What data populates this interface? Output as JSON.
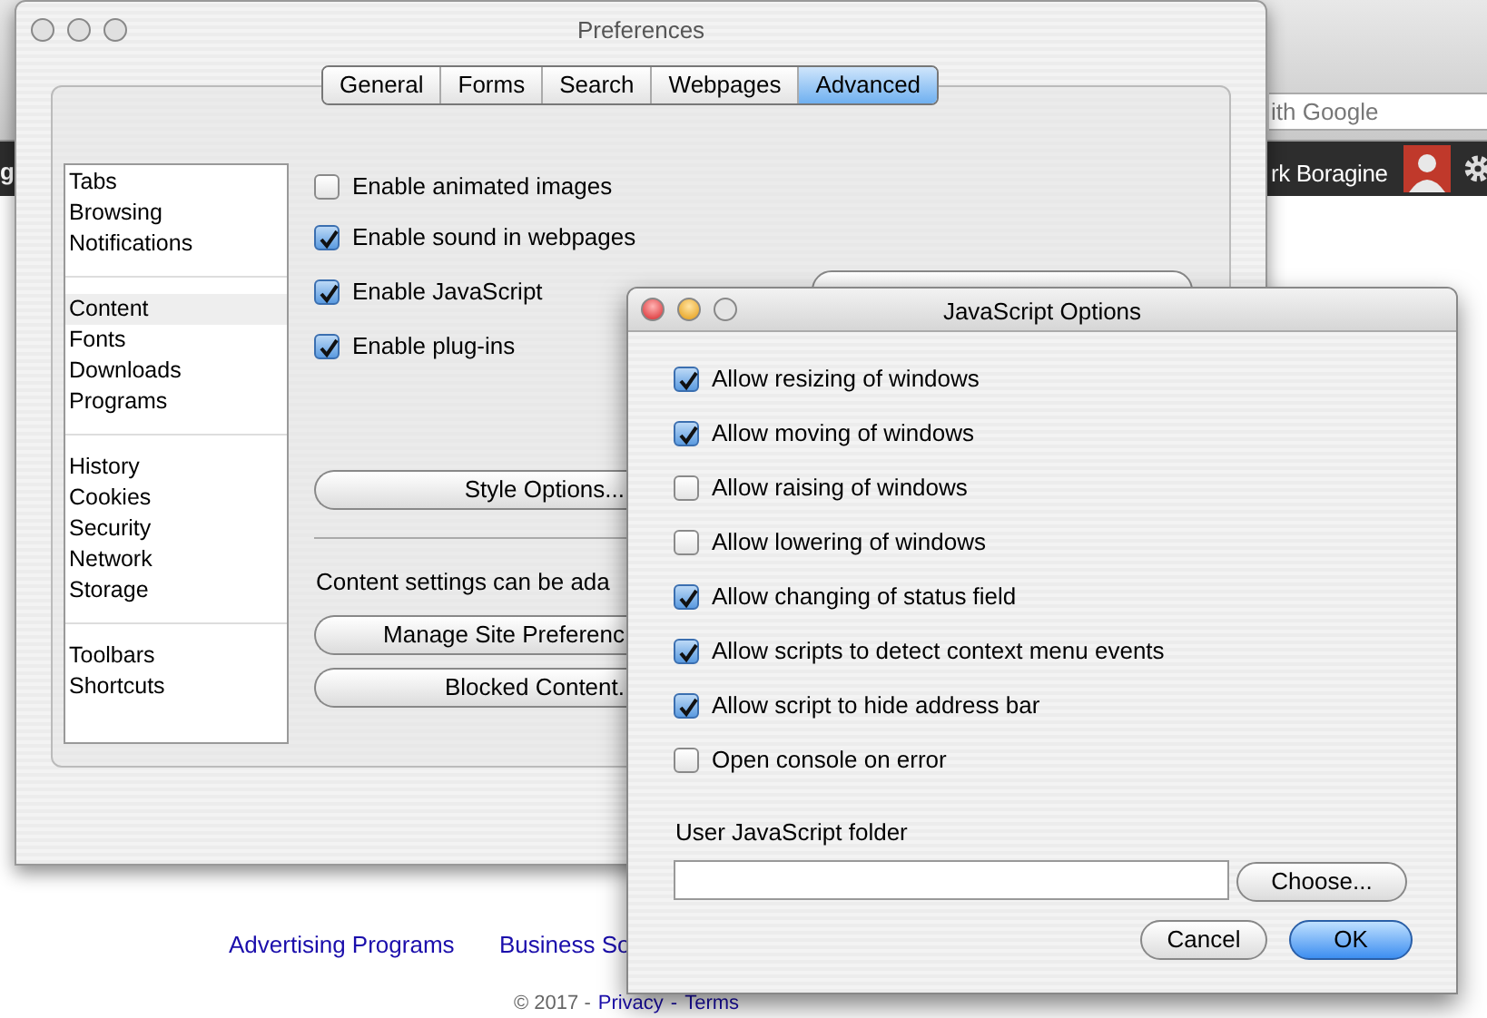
{
  "browser": {
    "search_placeholder": "ith Google",
    "left_fragment": "g",
    "user_name": "rk Boragine",
    "footer_links": [
      "Advertising Programs",
      "Business So"
    ],
    "copyright": "© 2017 -",
    "privacy": "Privacy",
    "separator": "-",
    "terms": "Terms"
  },
  "preferences": {
    "title": "Preferences",
    "tabs": [
      {
        "label": "General",
        "selected": false
      },
      {
        "label": "Forms",
        "selected": false
      },
      {
        "label": "Search",
        "selected": false
      },
      {
        "label": "Webpages",
        "selected": false
      },
      {
        "label": "Advanced",
        "selected": true
      }
    ],
    "sidebar": [
      [
        {
          "label": "Tabs",
          "selected": false
        },
        {
          "label": "Browsing",
          "selected": false
        },
        {
          "label": "Notifications",
          "selected": false
        }
      ],
      [
        {
          "label": "Content",
          "selected": true
        },
        {
          "label": "Fonts",
          "selected": false
        },
        {
          "label": "Downloads",
          "selected": false
        },
        {
          "label": "Programs",
          "selected": false
        }
      ],
      [
        {
          "label": "History",
          "selected": false
        },
        {
          "label": "Cookies",
          "selected": false
        },
        {
          "label": "Security",
          "selected": false
        },
        {
          "label": "Network",
          "selected": false
        },
        {
          "label": "Storage",
          "selected": false
        }
      ],
      [
        {
          "label": "Toolbars",
          "selected": false
        },
        {
          "label": "Shortcuts",
          "selected": false
        }
      ]
    ],
    "checkboxes": [
      {
        "label": "Enable animated images",
        "checked": false
      },
      {
        "label": "Enable sound in webpages",
        "checked": true
      },
      {
        "label": "Enable JavaScript",
        "checked": true
      },
      {
        "label": "Enable plug-ins",
        "checked": true
      }
    ],
    "style_options_button": "Style Options...",
    "content_settings_text": "Content settings can be ada",
    "manage_button": "Manage Site Preferenc",
    "blocked_button": "Blocked Content."
  },
  "javascript_dialog": {
    "title": "JavaScript Options",
    "options": [
      {
        "label": "Allow resizing of windows",
        "checked": true
      },
      {
        "label": "Allow moving of windows",
        "checked": true
      },
      {
        "label": "Allow raising of windows",
        "checked": false
      },
      {
        "label": "Allow lowering of windows",
        "checked": false
      },
      {
        "label": "Allow changing of status field",
        "checked": true
      },
      {
        "label": "Allow scripts to detect context menu events",
        "checked": true
      },
      {
        "label": "Allow script to hide address bar",
        "checked": true
      },
      {
        "label": "Open console on error",
        "checked": false
      }
    ],
    "folder_label": "User JavaScript folder",
    "choose_button": "Choose...",
    "cancel_button": "Cancel",
    "ok_button": "OK"
  }
}
